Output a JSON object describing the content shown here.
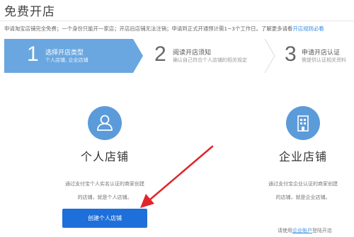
{
  "page": {
    "title": "免费开店",
    "notice_text": "申请淘宝店铺完全免费；一个身份只能开一家店；开店后店铺无法注销；申请到正式开通预计需1~3个工作日。了解更多请看",
    "notice_link": "开店规则必看"
  },
  "steps": [
    {
      "number": "1",
      "title": "选择开店类型",
      "subtitle": "个人店铺, 企业店铺"
    },
    {
      "number": "2",
      "title": "阅读开店须知",
      "subtitle": "确认自己符合个人店铺的相关规定"
    },
    {
      "number": "3",
      "title": "申请开店认证",
      "subtitle": "需提供认证相关资料"
    }
  ],
  "personal_shop": {
    "title": "个人店铺",
    "desc_line1": "通过支付宝个人实名认证的商家创建",
    "desc_line2": "的店铺，就是个人店铺。",
    "button_label": "创建个人店铺"
  },
  "enterprise_shop": {
    "title": "企业店铺",
    "desc_line1": "通过支付宝企业认证的商家创建",
    "desc_line2": "的店铺，就是企业店铺。",
    "note_prefix": "请使用",
    "note_link": "企业账户",
    "note_suffix": "登陆开店"
  },
  "colors": {
    "active_step": "#6aa7e0",
    "icon_circle": "#5b9bd9",
    "button": "#1e6fd9",
    "link": "#3a8ee6",
    "annotation_arrow": "#e0262b"
  },
  "icons": {
    "personal": "person-icon",
    "enterprise": "building-icon"
  }
}
